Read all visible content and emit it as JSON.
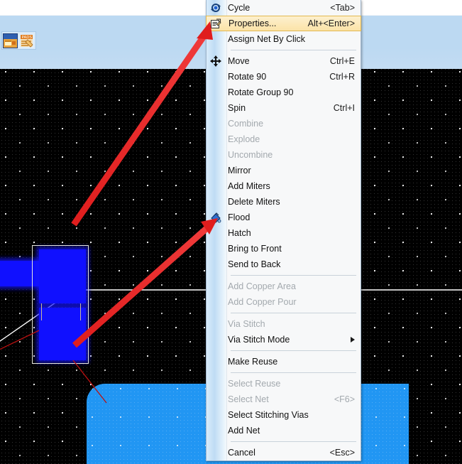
{
  "window": {
    "band_color": "#bcd9f2",
    "canvas_bg": "#000000"
  },
  "taskbar": {
    "icons": [
      {
        "name": "pcb-app-icon",
        "label": "PCB Layout"
      },
      {
        "name": "pads-app-icon",
        "label": "PADS"
      }
    ]
  },
  "canvas": {
    "pads": [
      {
        "name": "pad-left-trace",
        "color": "#1010ff"
      },
      {
        "name": "pad-upper",
        "color": "#1010ff"
      },
      {
        "name": "pad-lower",
        "color": "#1010ff"
      }
    ],
    "copper_pour": {
      "name": "copper-pour-region",
      "color": "#2196f3"
    },
    "board_outline_color": "#ffffff",
    "selection_color": "#e8e8e0"
  },
  "annotations": {
    "arrow_color": "#ee2222",
    "arrows": [
      {
        "name": "arrow-to-properties",
        "points_to": "Properties..."
      },
      {
        "name": "arrow-to-flood",
        "points_to": "Flood"
      }
    ]
  },
  "context_menu": {
    "title": "PCB object context menu",
    "items": [
      {
        "label": "Cycle",
        "accel": "<Tab>",
        "disabled": false,
        "icon": "cycle-icon",
        "sep_after": false
      },
      {
        "label": "Properties...",
        "accel": "Alt+<Enter>",
        "disabled": false,
        "icon": "properties-icon",
        "sep_after": false,
        "highlighted": true
      },
      {
        "label": "Assign Net By Click",
        "accel": "",
        "disabled": false,
        "icon": "",
        "sep_after": true
      },
      {
        "label": "Move",
        "accel": "Ctrl+E",
        "disabled": false,
        "icon": "move-icon",
        "sep_after": false
      },
      {
        "label": "Rotate 90",
        "accel": "Ctrl+R",
        "disabled": false,
        "icon": "",
        "sep_after": false
      },
      {
        "label": "Rotate Group 90",
        "accel": "",
        "disabled": false,
        "icon": "",
        "sep_after": false
      },
      {
        "label": "Spin",
        "accel": "Ctrl+I",
        "disabled": false,
        "icon": "",
        "sep_after": false
      },
      {
        "label": "Combine",
        "accel": "",
        "disabled": true,
        "icon": "",
        "sep_after": false
      },
      {
        "label": "Explode",
        "accel": "",
        "disabled": true,
        "icon": "",
        "sep_after": false
      },
      {
        "label": "Uncombine",
        "accel": "",
        "disabled": true,
        "icon": "",
        "sep_after": false
      },
      {
        "label": "Mirror",
        "accel": "",
        "disabled": false,
        "icon": "",
        "sep_after": false
      },
      {
        "label": "Add Miters",
        "accel": "",
        "disabled": false,
        "icon": "",
        "sep_after": false
      },
      {
        "label": "Delete Miters",
        "accel": "",
        "disabled": false,
        "icon": "",
        "sep_after": false
      },
      {
        "label": "Flood",
        "accel": "",
        "disabled": false,
        "icon": "flood-icon",
        "sep_after": false
      },
      {
        "label": "Hatch",
        "accel": "",
        "disabled": false,
        "icon": "",
        "sep_after": false
      },
      {
        "label": "Bring to Front",
        "accel": "",
        "disabled": false,
        "icon": "",
        "sep_after": false
      },
      {
        "label": "Send to Back",
        "accel": "",
        "disabled": false,
        "icon": "",
        "sep_after": true
      },
      {
        "label": "Add Copper Area",
        "accel": "",
        "disabled": true,
        "icon": "",
        "sep_after": false
      },
      {
        "label": "Add Copper Pour",
        "accel": "",
        "disabled": true,
        "icon": "",
        "sep_after": true
      },
      {
        "label": "Via Stitch",
        "accel": "",
        "disabled": true,
        "icon": "",
        "sep_after": false
      },
      {
        "label": "Via Stitch Mode",
        "accel": "",
        "disabled": false,
        "icon": "",
        "sep_after": true,
        "submenu": true
      },
      {
        "label": "Make Reuse",
        "accel": "",
        "disabled": false,
        "icon": "",
        "sep_after": true
      },
      {
        "label": "Select Reuse",
        "accel": "",
        "disabled": true,
        "icon": "",
        "sep_after": false
      },
      {
        "label": "Select Net",
        "accel": "<F6>",
        "disabled": true,
        "icon": "",
        "sep_after": false
      },
      {
        "label": "Select Stitching Vias",
        "accel": "",
        "disabled": false,
        "icon": "",
        "sep_after": false
      },
      {
        "label": "Add Net",
        "accel": "",
        "disabled": false,
        "icon": "",
        "sep_after": true
      },
      {
        "label": "Cancel",
        "accel": "<Esc>",
        "disabled": false,
        "icon": "",
        "sep_after": false
      }
    ]
  }
}
